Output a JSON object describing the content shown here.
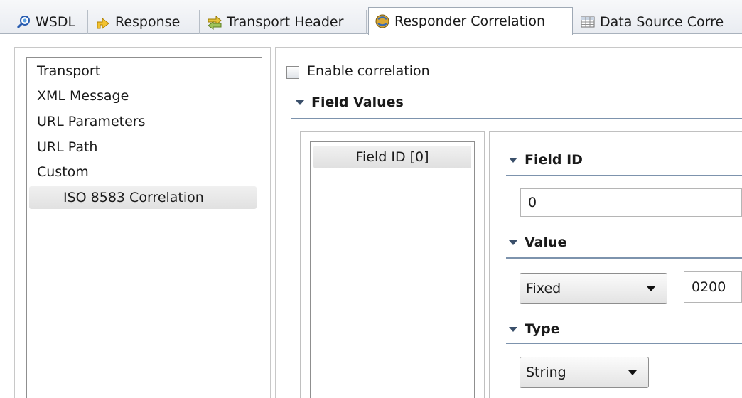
{
  "tabs": [
    {
      "label": "WSDL",
      "icon": "wsdl-icon"
    },
    {
      "label": "Response",
      "icon": "response-arrow-icon"
    },
    {
      "label": "Transport Header",
      "icon": "transport-header-icon"
    },
    {
      "label": "Responder Correlation",
      "icon": "responder-correlation-icon"
    },
    {
      "label": "Data Source Corre",
      "icon": "data-source-table-icon"
    }
  ],
  "sidebar": {
    "items": [
      {
        "label": "Transport"
      },
      {
        "label": "XML Message"
      },
      {
        "label": "URL Parameters"
      },
      {
        "label": "URL Path"
      },
      {
        "label": "Custom"
      },
      {
        "label": "ISO 8583 Correlation",
        "selected": true
      }
    ]
  },
  "main": {
    "enable_correlation_label": "Enable correlation",
    "enable_correlation_checked": false,
    "field_values_title": "Field Values",
    "field_list": [
      {
        "label": "Field ID [0]"
      }
    ],
    "field_id_title": "Field ID",
    "field_id_value": "0",
    "value_title": "Value",
    "value_mode": "Fixed",
    "value_value": "0200",
    "type_title": "Type",
    "type_value": "String"
  },
  "colors": {
    "section_rule": "#7d93ad",
    "tab_bar": "#e9ecf1"
  }
}
